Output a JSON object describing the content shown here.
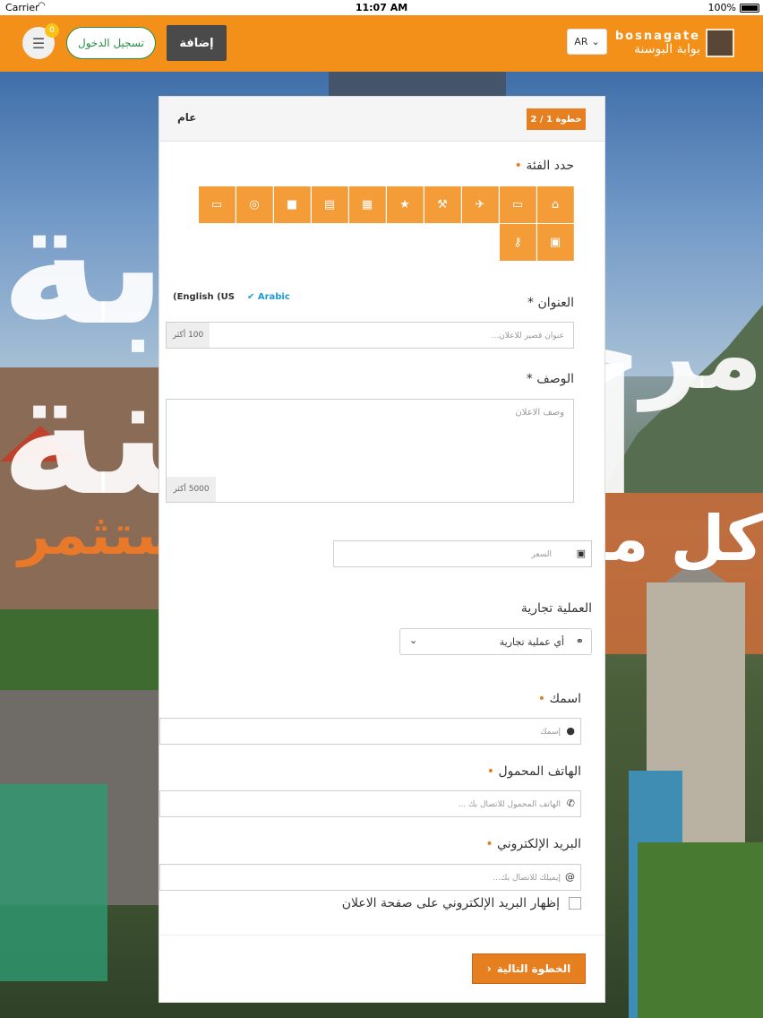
{
  "status_bar": {
    "carrier": "Carrier",
    "time": "11:07 AM",
    "battery": "100%"
  },
  "header": {
    "brand_en": "bosnagate",
    "brand_ar": "بوابة البوسنة",
    "language": "AR",
    "add_label": "إضافة",
    "login_label": "تسجيل الدخول",
    "menu_badge": "0",
    "accent_color": "#f39019"
  },
  "background": {
    "big_text_1": "بوابة البوسنة",
    "big_text_2": "مرحباً بكم",
    "orange_text": "ستثمر",
    "white_text": "كل ما ب"
  },
  "form": {
    "step": "خطوة 1 / 2",
    "title": "عام",
    "category_label": "حدد الفئة",
    "category_required": "•",
    "category_icons": [
      "home-icon",
      "car-icon",
      "plane-icon",
      "wrench-icon",
      "star-icon",
      "grid-icon",
      "newspaper-icon",
      "truck-icon",
      "compass-icon",
      "monitor-icon",
      "briefcase-icon",
      "key-icon"
    ],
    "title_label": "العنوان",
    "title_required": "*",
    "lang_tab_en": "(English (US",
    "lang_tab_ar": "Arabic",
    "title_placeholder": "عنوان قصير للاعلان...",
    "title_counter": "100 أكثر",
    "desc_label": "الوصف",
    "desc_required": "*",
    "desc_placeholder": "وصف الاعلان",
    "desc_counter": "5000 أكثر",
    "price_placeholder": "السعر",
    "business_label": "العملية تجارية",
    "business_value": "أي عملية تجارية",
    "name_label": "اسمك",
    "name_required": "•",
    "name_placeholder": "إسمك",
    "phone_label": "الهاتف المحمول",
    "phone_required": "•",
    "phone_placeholder": "الهاتف المحمول للاتصال بك ...",
    "email_label": "البريد الإلكتروني",
    "email_required": "•",
    "email_placeholder": "إيميلك للاتصال بك...",
    "show_email_label": "إظهار البريد الإلكتروني على صفحة الاعلان",
    "next_label": "الخطوة التالية",
    "next_arrow": "‹"
  }
}
